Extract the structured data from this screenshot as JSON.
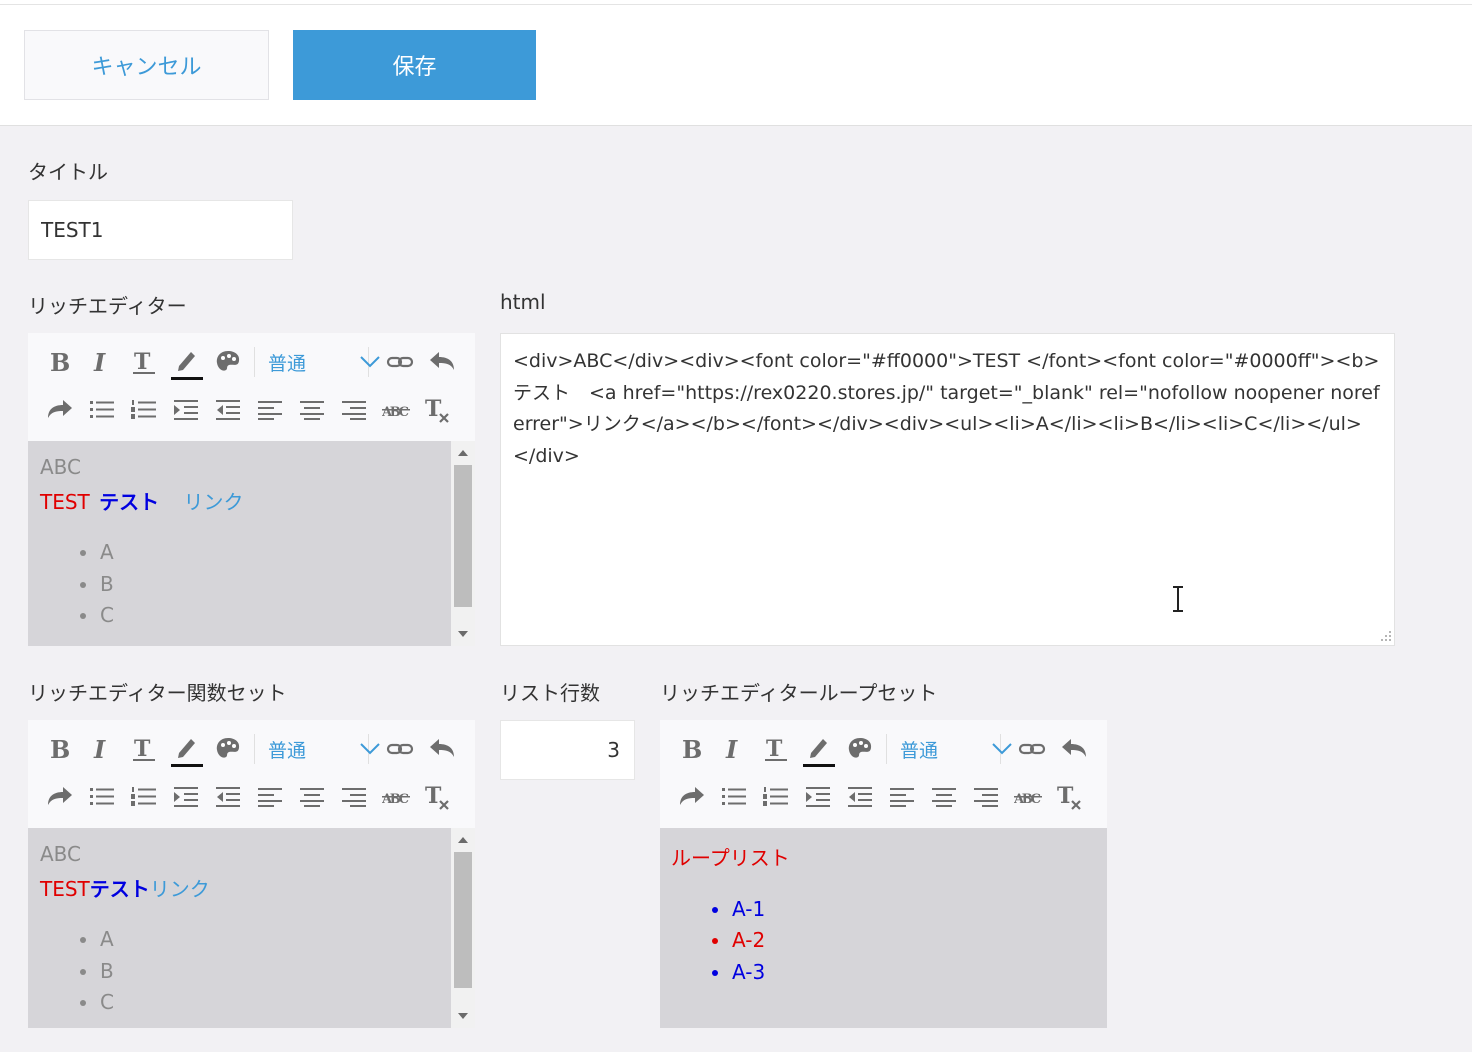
{
  "header": {
    "cancel_label": "キャンセル",
    "save_label": "保存"
  },
  "fields": {
    "title_label": "タイトル",
    "title_value": "TEST1",
    "rich_label": "リッチエディター",
    "html_label": "html",
    "html_value": "<div>ABC</div><div><font color=\"#ff0000\">TEST </font><font color=\"#0000ff\"><b>テスト　<a href=\"https://rex0220.stores.jp/\" target=\"_blank\" rel=\"nofollow noopener noreferrer\">リンク</a></b></font></div><div><ul><li>A</li><li>B</li><li>C</li></ul></div>",
    "func_label": "リッチエディター関数セット",
    "rows_label": "リスト行数",
    "rows_value": "3",
    "loop_label": "リッチエディターループセット"
  },
  "toolbar": {
    "format_label": "普通",
    "icons": [
      "bold-icon",
      "italic-icon",
      "text-size-icon",
      "font-color-icon",
      "palette-icon",
      "format-dropdown",
      "link-icon",
      "undo-icon",
      "redo-icon",
      "bulleted-list-icon",
      "numbered-list-icon",
      "indent-icon",
      "outdent-icon",
      "align-left-icon",
      "align-center-icon",
      "align-right-icon",
      "strikethrough-icon",
      "clear-format-icon"
    ]
  },
  "editor1": {
    "line1": "ABC",
    "red_text": "TEST",
    "blue_text": "テスト",
    "link_text": "リンク",
    "items": [
      "A",
      "B",
      "C"
    ]
  },
  "editor2": {
    "line1": "ABC",
    "red_text": "TEST",
    "blue_text": "テスト",
    "link_text": "リンク",
    "items": [
      "A",
      "B",
      "C"
    ]
  },
  "editor3": {
    "heading": "ループリスト",
    "items": [
      {
        "text": "A-1",
        "color": "#0000e0"
      },
      {
        "text": "A-2",
        "color": "#e00000"
      },
      {
        "text": "A-3",
        "color": "#0000e0"
      }
    ]
  },
  "colors": {
    "accent": "#3d9ad8",
    "red": "#e00000",
    "blue": "#0000e0",
    "editor_bg": "#d6d5d9",
    "page_bg": "#f2f1f4"
  }
}
